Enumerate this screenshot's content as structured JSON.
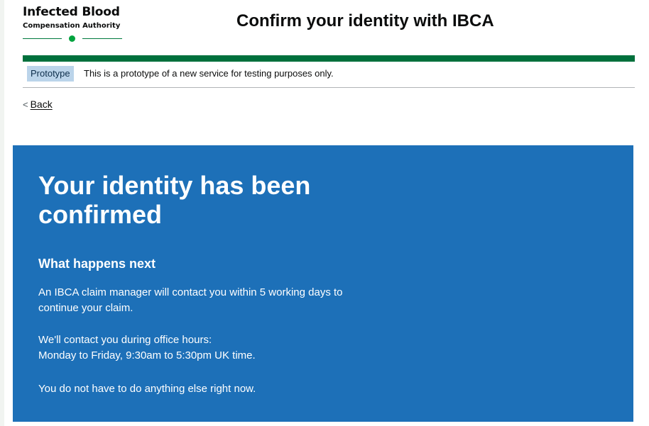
{
  "header": {
    "logo_line1": "Infected Blood",
    "logo_line2": "Compensation Authority",
    "service_name": "Confirm your identity with IBCA"
  },
  "phase_banner": {
    "tag": "Prototype",
    "text": "This is a prototype of a new service for testing purposes only."
  },
  "back_link": {
    "label": "Back"
  },
  "panel": {
    "title": "Your identity has been confirmed",
    "subheading": "What happens next",
    "paragraph1": [
      "An IBCA claim manager will contact you within 5 working days to",
      "continue your claim."
    ],
    "paragraph2": [
      "We'll contact you during office hours:",
      "Monday to Friday, 9:30am to 5:30pm UK time."
    ],
    "paragraph3": "You do not have to do anything else right now."
  },
  "colors": {
    "brand_green": "#00703c",
    "panel_blue": "#1d70b8",
    "tag_blue": "#bbd4ea",
    "logo_dot": "#00a33e"
  },
  "icons": {
    "back": "chevron-left-icon",
    "logo": "logo-dot-icon"
  }
}
